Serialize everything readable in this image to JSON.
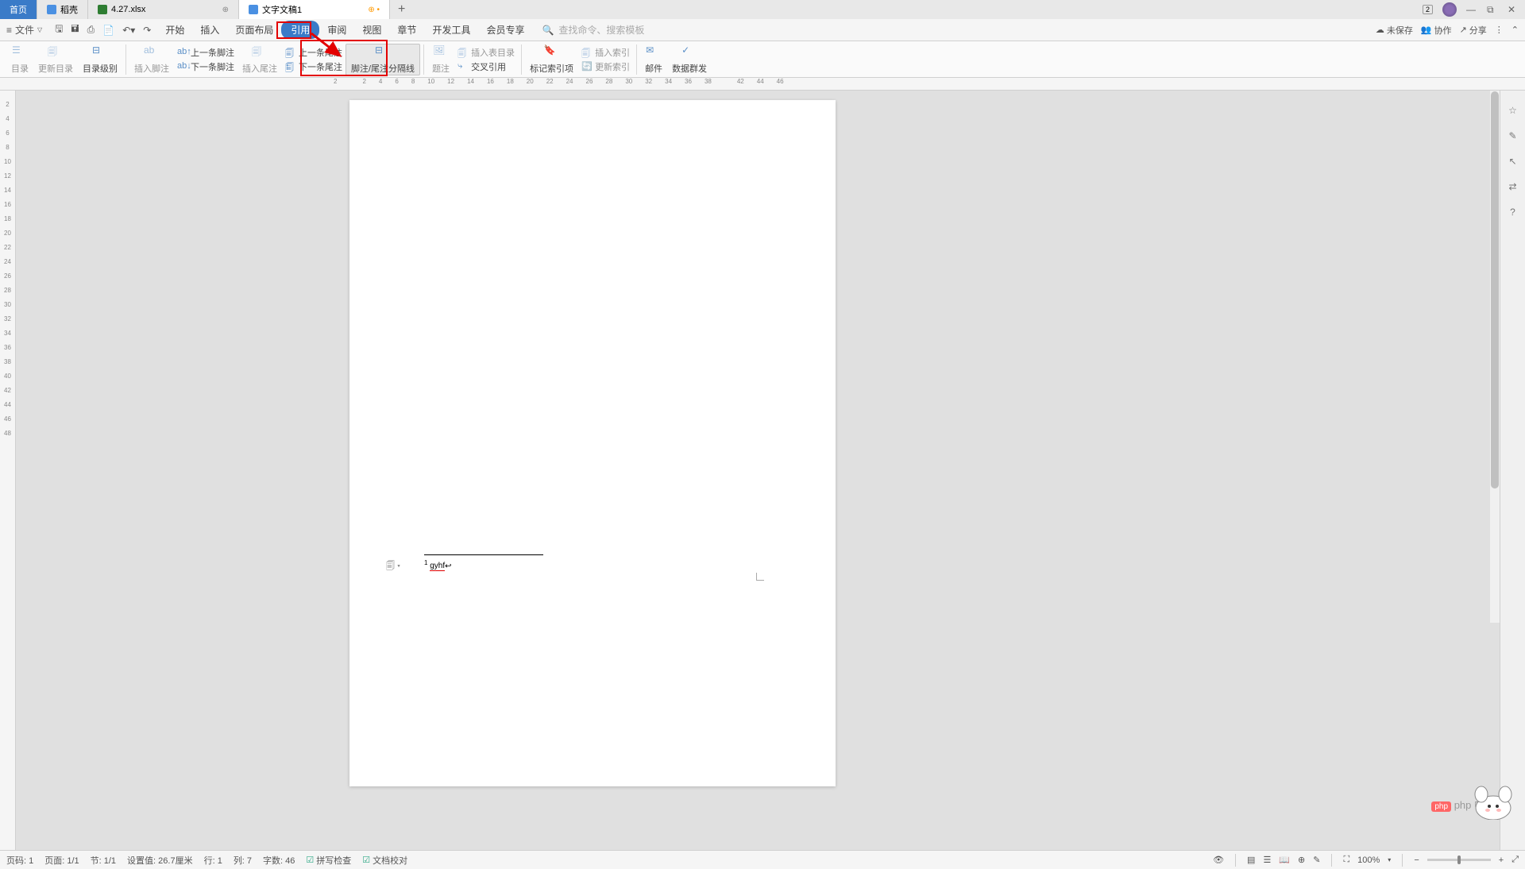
{
  "tabs": {
    "home": "首页",
    "doc": "稻壳",
    "xls": "4.27.xlsx",
    "word": "文字文稿1"
  },
  "window": {
    "badge": "2"
  },
  "menubar": {
    "file": "文件",
    "tabs": [
      "开始",
      "插入",
      "页面布局",
      "引用",
      "审阅",
      "视图",
      "章节",
      "开发工具",
      "会员专享"
    ],
    "active_index": 3,
    "search_placeholder": "查找命令、搜索模板",
    "right": {
      "unsaved": "未保存",
      "collab": "协作",
      "share": "分享"
    }
  },
  "ribbon": {
    "toc": "目录",
    "update_toc": "更新目录",
    "toc_level": "目录级别",
    "insert_footnote": "插入脚注",
    "prev_footnote": "上一条脚注",
    "next_footnote": "下一条脚注",
    "insert_endnote": "插入尾注",
    "prev_endnote": "上一条尾注",
    "next_endnote": "下一条尾注",
    "separator": "脚注/尾注分隔线",
    "caption": "题注",
    "insert_caption": "插入表目录",
    "cross_ref": "交叉引用",
    "mark_index": "标记索引项",
    "insert_index": "插入索引",
    "update_index": "更新索引",
    "mail": "邮件",
    "mail_merge": "数据群发"
  },
  "ruler_h": [
    "2",
    "",
    "2",
    "4",
    "6",
    "8",
    "10",
    "12",
    "14",
    "16",
    "18",
    "20",
    "22",
    "24",
    "26",
    "28",
    "30",
    "32",
    "34",
    "36",
    "38",
    "",
    "42",
    "44",
    "46"
  ],
  "ruler_v": [
    "",
    "2",
    "4",
    "6",
    "8",
    "10",
    "12",
    "14",
    "16",
    "18",
    "20",
    "22",
    "24",
    "26",
    "28",
    "30",
    "32",
    "34",
    "36",
    "38",
    "40",
    "42",
    "44",
    "46",
    "48"
  ],
  "document": {
    "footnote_ref": "1",
    "footnote_text": "gyhf"
  },
  "statusbar": {
    "page_code": "页码: 1",
    "page": "页面: 1/1",
    "section": "节: 1/1",
    "position": "设置值: 26.7厘米",
    "row": "行: 1",
    "col": "列: 7",
    "chars": "字数: 46",
    "spell": "拼写检查",
    "proof": "文档校对",
    "zoom": "100%"
  },
  "watermark": "php 中文网"
}
